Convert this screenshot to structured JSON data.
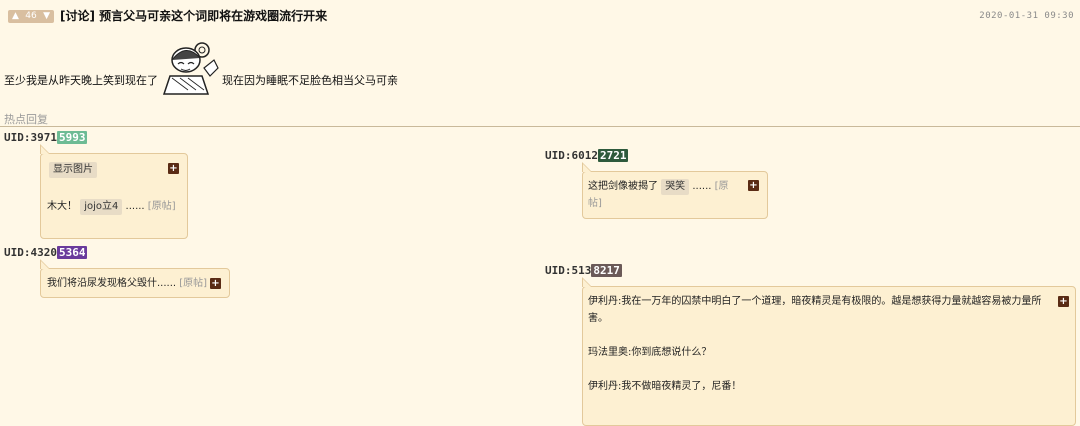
{
  "header": {
    "like_count": "46",
    "title": "[讨论] 预言父马可亲这个词即将在游戏圈流行开来",
    "date": "2020-01-31 09:30"
  },
  "post": {
    "text_before": "至少我是从昨天晚上笑到现在了",
    "text_after": "现在因为睡眠不足脸色相当父马可亲"
  },
  "section": {
    "hot_label": "热点回复"
  },
  "replies": [
    {
      "uid_prefix": "UID:3971",
      "uid_suffix": "5993",
      "badge_color": "#6dbb94",
      "show_image": "显示图片",
      "text": "木大！",
      "chip": "jojo立4",
      "dots": "......",
      "ref": "[原帖]"
    },
    {
      "uid_prefix": "UID:4320",
      "uid_suffix": "5364",
      "badge_color": "#6a3b9c",
      "text": "我们将沿尿发现格父毁什......",
      "ref": "[原帖]"
    },
    {
      "uid_prefix": "UID:6012",
      "uid_suffix": "2721",
      "badge_color": "#2e5a3c",
      "text": "这把剑像被揭了",
      "chip": "哭笑",
      "dots": "......",
      "ref": "[原帖]"
    },
    {
      "uid_prefix": "UID:513",
      "uid_suffix": "8217",
      "badge_color": "#6b5a58",
      "lines": [
        "伊利丹:我在一万年的囚禁中明白了一个道理，暗夜精灵是有极限的。越是想获得力量就越容易被力量所害。",
        "玛法里奥:你到底想说什么？",
        "伊利丹:我不做暗夜精灵了，尼番！"
      ]
    }
  ],
  "icons": {
    "plus": "+",
    "thumb_up": "👍",
    "thumb_down": "👎"
  }
}
